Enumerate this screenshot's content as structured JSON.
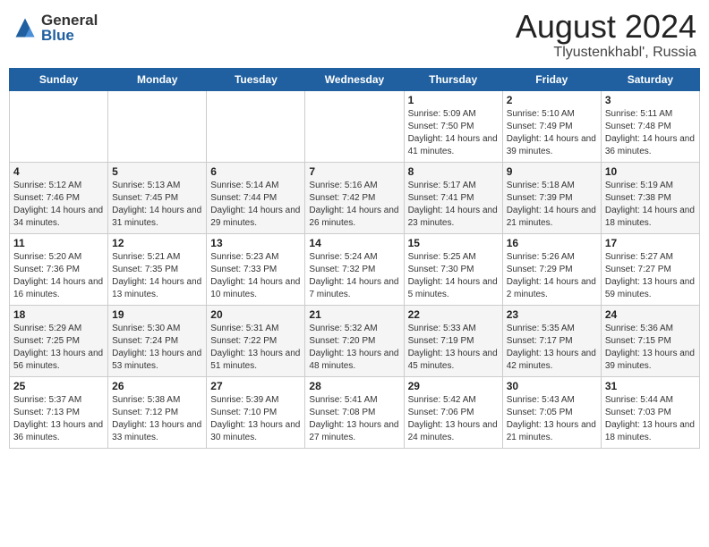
{
  "header": {
    "logo_general": "General",
    "logo_blue": "Blue",
    "main_title": "August 2024",
    "subtitle": "Tlyustenkhabl', Russia"
  },
  "weekdays": [
    "Sunday",
    "Monday",
    "Tuesday",
    "Wednesday",
    "Thursday",
    "Friday",
    "Saturday"
  ],
  "weeks": [
    [
      {
        "day": "",
        "info": ""
      },
      {
        "day": "",
        "info": ""
      },
      {
        "day": "",
        "info": ""
      },
      {
        "day": "",
        "info": ""
      },
      {
        "day": "1",
        "info": "Sunrise: 5:09 AM\nSunset: 7:50 PM\nDaylight: 14 hours and 41 minutes."
      },
      {
        "day": "2",
        "info": "Sunrise: 5:10 AM\nSunset: 7:49 PM\nDaylight: 14 hours and 39 minutes."
      },
      {
        "day": "3",
        "info": "Sunrise: 5:11 AM\nSunset: 7:48 PM\nDaylight: 14 hours and 36 minutes."
      }
    ],
    [
      {
        "day": "4",
        "info": "Sunrise: 5:12 AM\nSunset: 7:46 PM\nDaylight: 14 hours and 34 minutes."
      },
      {
        "day": "5",
        "info": "Sunrise: 5:13 AM\nSunset: 7:45 PM\nDaylight: 14 hours and 31 minutes."
      },
      {
        "day": "6",
        "info": "Sunrise: 5:14 AM\nSunset: 7:44 PM\nDaylight: 14 hours and 29 minutes."
      },
      {
        "day": "7",
        "info": "Sunrise: 5:16 AM\nSunset: 7:42 PM\nDaylight: 14 hours and 26 minutes."
      },
      {
        "day": "8",
        "info": "Sunrise: 5:17 AM\nSunset: 7:41 PM\nDaylight: 14 hours and 23 minutes."
      },
      {
        "day": "9",
        "info": "Sunrise: 5:18 AM\nSunset: 7:39 PM\nDaylight: 14 hours and 21 minutes."
      },
      {
        "day": "10",
        "info": "Sunrise: 5:19 AM\nSunset: 7:38 PM\nDaylight: 14 hours and 18 minutes."
      }
    ],
    [
      {
        "day": "11",
        "info": "Sunrise: 5:20 AM\nSunset: 7:36 PM\nDaylight: 14 hours and 16 minutes."
      },
      {
        "day": "12",
        "info": "Sunrise: 5:21 AM\nSunset: 7:35 PM\nDaylight: 14 hours and 13 minutes."
      },
      {
        "day": "13",
        "info": "Sunrise: 5:23 AM\nSunset: 7:33 PM\nDaylight: 14 hours and 10 minutes."
      },
      {
        "day": "14",
        "info": "Sunrise: 5:24 AM\nSunset: 7:32 PM\nDaylight: 14 hours and 7 minutes."
      },
      {
        "day": "15",
        "info": "Sunrise: 5:25 AM\nSunset: 7:30 PM\nDaylight: 14 hours and 5 minutes."
      },
      {
        "day": "16",
        "info": "Sunrise: 5:26 AM\nSunset: 7:29 PM\nDaylight: 14 hours and 2 minutes."
      },
      {
        "day": "17",
        "info": "Sunrise: 5:27 AM\nSunset: 7:27 PM\nDaylight: 13 hours and 59 minutes."
      }
    ],
    [
      {
        "day": "18",
        "info": "Sunrise: 5:29 AM\nSunset: 7:25 PM\nDaylight: 13 hours and 56 minutes."
      },
      {
        "day": "19",
        "info": "Sunrise: 5:30 AM\nSunset: 7:24 PM\nDaylight: 13 hours and 53 minutes."
      },
      {
        "day": "20",
        "info": "Sunrise: 5:31 AM\nSunset: 7:22 PM\nDaylight: 13 hours and 51 minutes."
      },
      {
        "day": "21",
        "info": "Sunrise: 5:32 AM\nSunset: 7:20 PM\nDaylight: 13 hours and 48 minutes."
      },
      {
        "day": "22",
        "info": "Sunrise: 5:33 AM\nSunset: 7:19 PM\nDaylight: 13 hours and 45 minutes."
      },
      {
        "day": "23",
        "info": "Sunrise: 5:35 AM\nSunset: 7:17 PM\nDaylight: 13 hours and 42 minutes."
      },
      {
        "day": "24",
        "info": "Sunrise: 5:36 AM\nSunset: 7:15 PM\nDaylight: 13 hours and 39 minutes."
      }
    ],
    [
      {
        "day": "25",
        "info": "Sunrise: 5:37 AM\nSunset: 7:13 PM\nDaylight: 13 hours and 36 minutes."
      },
      {
        "day": "26",
        "info": "Sunrise: 5:38 AM\nSunset: 7:12 PM\nDaylight: 13 hours and 33 minutes."
      },
      {
        "day": "27",
        "info": "Sunrise: 5:39 AM\nSunset: 7:10 PM\nDaylight: 13 hours and 30 minutes."
      },
      {
        "day": "28",
        "info": "Sunrise: 5:41 AM\nSunset: 7:08 PM\nDaylight: 13 hours and 27 minutes."
      },
      {
        "day": "29",
        "info": "Sunrise: 5:42 AM\nSunset: 7:06 PM\nDaylight: 13 hours and 24 minutes."
      },
      {
        "day": "30",
        "info": "Sunrise: 5:43 AM\nSunset: 7:05 PM\nDaylight: 13 hours and 21 minutes."
      },
      {
        "day": "31",
        "info": "Sunrise: 5:44 AM\nSunset: 7:03 PM\nDaylight: 13 hours and 18 minutes."
      }
    ]
  ]
}
